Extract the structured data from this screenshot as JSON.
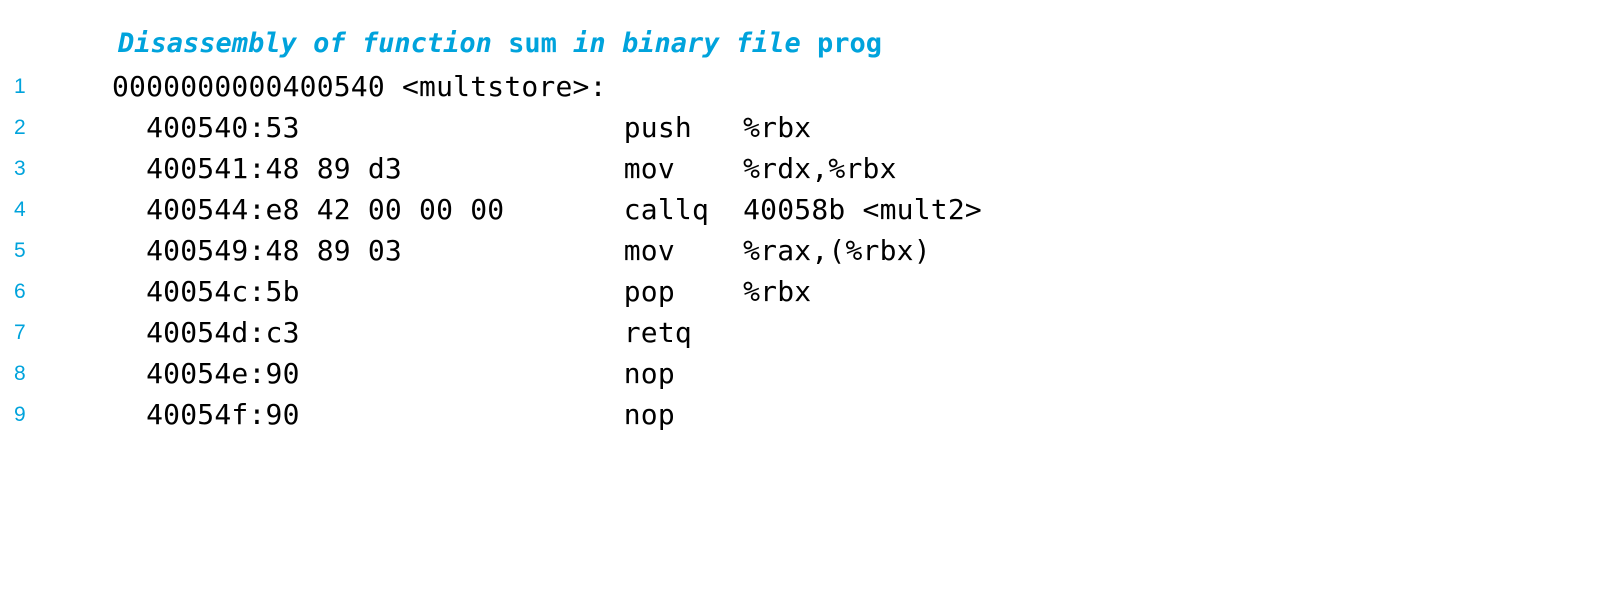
{
  "caption": {
    "prefix_italic": "Disassembly of function ",
    "symbol_1": "sum",
    "middle_italic": " in binary file ",
    "symbol_2": "prog",
    "full_text": "Disassembly of function sum in binary file prog",
    "color": "#00a3dc"
  },
  "colors": {
    "accent": "#00a3dc",
    "code": "#000000",
    "background": "#ffffff"
  },
  "listing": {
    "object_file": "prog",
    "function": "sum",
    "symbol_header": "0000000000400540 <multstore>:",
    "lines": [
      {
        "number": "1",
        "text": "0000000000400540 <multstore>:",
        "address": "0000000000400540",
        "symbol": "<multstore>",
        "bytes": "",
        "mnemonic": "",
        "operands": ""
      },
      {
        "number": "2",
        "text": "  400540:\t53                   \tpush   %rbx",
        "address": "400540:",
        "bytes": "53",
        "mnemonic": "push",
        "operands": "%rbx"
      },
      {
        "number": "3",
        "text": "  400541:\t48 89 d3             \tmov    %rdx,%rbx",
        "address": "400541:",
        "bytes": "48 89 d3",
        "mnemonic": "mov",
        "operands": "%rdx,%rbx"
      },
      {
        "number": "4",
        "text": "  400544:\te8 42 00 00 00       \tcallq  40058b <mult2>",
        "address": "400544:",
        "bytes": "e8 42 00 00 00",
        "mnemonic": "callq",
        "operands": "40058b <mult2>"
      },
      {
        "number": "5",
        "text": "  400549:\t48 89 03             \tmov    %rax,(%rbx)",
        "address": "400549:",
        "bytes": "48 89 03",
        "mnemonic": "mov",
        "operands": "%rax,(%rbx)"
      },
      {
        "number": "6",
        "text": "  40054c:\t5b                   \tpop    %rbx",
        "address": "40054c:",
        "bytes": "5b",
        "mnemonic": "pop",
        "operands": "%rbx"
      },
      {
        "number": "7",
        "text": "  40054d:\tc3                   \tretq",
        "address": "40054d:",
        "bytes": "c3",
        "mnemonic": "retq",
        "operands": ""
      },
      {
        "number": "8",
        "text": "  40054e:\t90                   \tnop",
        "address": "40054e:",
        "bytes": "90",
        "mnemonic": "nop",
        "operands": ""
      },
      {
        "number": "9",
        "text": "  40054f:\t90                   \tnop",
        "address": "40054f:",
        "bytes": "90",
        "mnemonic": "nop",
        "operands": ""
      }
    ]
  }
}
